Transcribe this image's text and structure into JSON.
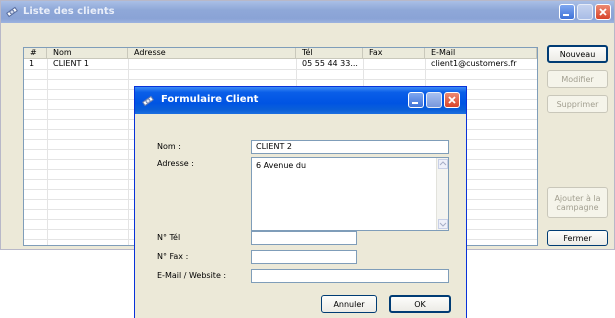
{
  "main_window": {
    "title": "Liste des clients",
    "columns": [
      "#",
      "Nom",
      "Adresse",
      "Tél",
      "Fax",
      "E-Mail"
    ],
    "rows": [
      {
        "num": "1",
        "nom": "CLIENT 1",
        "adresse": "",
        "tel": "05 55 44 33...",
        "fax": "",
        "email": "client1@customers.fr"
      }
    ],
    "buttons": {
      "nouveau": "Nouveau",
      "modifier": "Modifier",
      "supprimer": "Supprimer",
      "ajouter_line1": "Ajouter à la",
      "ajouter_line2": "campagne",
      "fermer": "Fermer"
    }
  },
  "dialog": {
    "title": "Formulaire Client",
    "labels": {
      "nom": "Nom :",
      "adresse": "Adresse :",
      "tel": "N° Tél",
      "fax": "N° Fax :",
      "email": "E-Mail / Website :"
    },
    "values": {
      "nom": "CLIENT 2",
      "adresse": "6 Avenue du",
      "tel": "",
      "fax": "",
      "email": ""
    },
    "buttons": {
      "annuler": "Annuler",
      "ok": "OK"
    }
  },
  "icons": {
    "window_icon": "satellite-icon",
    "minimize": "minimize-icon",
    "maximize": "maximize-icon",
    "close": "close-icon"
  },
  "colors": {
    "active_title": "#0054e3",
    "inactive_title": "#8fa8d8",
    "window_bg": "#ece9d8",
    "close_button": "#d8442a"
  }
}
